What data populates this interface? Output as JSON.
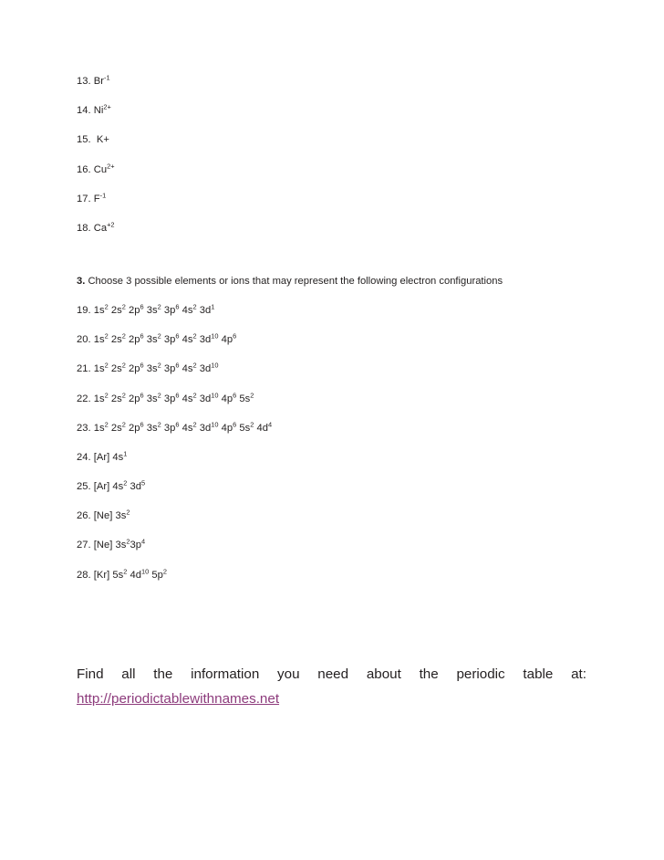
{
  "document": {
    "ions_section": {
      "items": [
        {
          "number": "13.",
          "symbol": "Br",
          "charge": "-1",
          "charge_style": "superscript"
        },
        {
          "number": "14.",
          "symbol": "Ni",
          "charge": "2+",
          "charge_style": "superscript"
        },
        {
          "number": "15.",
          "symbol": " K+",
          "charge": "",
          "charge_style": "inline"
        },
        {
          "number": "16.",
          "symbol": "Cu",
          "charge": "2+",
          "charge_style": "superscript"
        },
        {
          "number": "17.",
          "symbol": "F",
          "charge": "-1",
          "charge_style": "superscript"
        },
        {
          "number": "18.",
          "symbol": "Ca",
          "charge": "+2",
          "charge_style": "superscript"
        }
      ]
    },
    "section3": {
      "number": "3.",
      "prompt": " Choose 3 possible elements or ions that may represent the following electron configurations",
      "items": [
        {
          "number": "19.",
          "parts": [
            {
              "base": "1s",
              "sup": "2"
            },
            {
              "base": "2s",
              "sup": "2"
            },
            {
              "base": "2p",
              "sup": "6"
            },
            {
              "base": "3s",
              "sup": "2"
            },
            {
              "base": "3p",
              "sup": "6"
            },
            {
              "base": "4s",
              "sup": "2"
            },
            {
              "base": "3d",
              "sup": "1"
            }
          ],
          "text": "19. 1s2 2s2 2p6 3s2 3p6 4s2 3d1"
        },
        {
          "number": "20.",
          "parts": [
            {
              "base": "1s",
              "sup": "2"
            },
            {
              "base": "2s",
              "sup": "2"
            },
            {
              "base": "2p",
              "sup": "6"
            },
            {
              "base": "3s",
              "sup": "2"
            },
            {
              "base": "3p",
              "sup": "6"
            },
            {
              "base": "4s",
              "sup": "2"
            },
            {
              "base": "3d",
              "sup": "10"
            },
            {
              "base": "4p",
              "sup": "6"
            }
          ],
          "text": "20. 1s2 2s2 2p6 3s2 3p6 4s2 3d10 4p6"
        },
        {
          "number": "21.",
          "parts": [
            {
              "base": "1s",
              "sup": "2"
            },
            {
              "base": "2s",
              "sup": "2"
            },
            {
              "base": "2p",
              "sup": "6"
            },
            {
              "base": "3s",
              "sup": "2"
            },
            {
              "base": "3p",
              "sup": "6"
            },
            {
              "base": "4s",
              "sup": "2"
            },
            {
              "base": "3d",
              "sup": "10"
            }
          ],
          "text": "21. 1s2 2s2 2p6 3s2 3p6 4s2 3d10"
        },
        {
          "number": "22.",
          "parts": [
            {
              "base": "1s",
              "sup": "2"
            },
            {
              "base": "2s",
              "sup": "2"
            },
            {
              "base": "2p",
              "sup": "6"
            },
            {
              "base": "3s",
              "sup": "2"
            },
            {
              "base": "3p",
              "sup": "6"
            },
            {
              "base": "4s",
              "sup": "2"
            },
            {
              "base": "3d",
              "sup": "10"
            },
            {
              "base": "4p",
              "sup": "6"
            },
            {
              "base": "5s",
              "sup": "2"
            }
          ],
          "text": "22. 1s2 2s2 2p6 3s2 3p6 4s2 3d10 4p6 5s2"
        },
        {
          "number": "23.",
          "parts": [
            {
              "base": "1s",
              "sup": "2"
            },
            {
              "base": "2s",
              "sup": "2"
            },
            {
              "base": "2p",
              "sup": "6"
            },
            {
              "base": "3s",
              "sup": "2"
            },
            {
              "base": "3p",
              "sup": "6"
            },
            {
              "base": "4s",
              "sup": "2"
            },
            {
              "base": "3d",
              "sup": "10"
            },
            {
              "base": "4p",
              "sup": "6"
            },
            {
              "base": "5s",
              "sup": "2"
            },
            {
              "base": "4d",
              "sup": "4"
            }
          ],
          "text": "23. 1s2 2s2 2p6 3s2 3p6 4s2 3d10 4p6 5s2 4d4"
        },
        {
          "number": "24.",
          "parts": [
            {
              "base": "[Ar] 4s",
              "sup": "1"
            }
          ],
          "text": "24. [Ar] 4s1"
        },
        {
          "number": "25.",
          "parts": [
            {
              "base": "[Ar] 4s",
              "sup": "2"
            },
            {
              "base": "3d",
              "sup": "5"
            }
          ],
          "text": "25. [Ar] 4s2 3d5"
        },
        {
          "number": "26.",
          "parts": [
            {
              "base": "[Ne] 3s",
              "sup": "2"
            }
          ],
          "text": "26. [Ne] 3s2"
        },
        {
          "number": "27.",
          "parts": [
            {
              "base": "[Ne] 3s",
              "sup": "2"
            },
            {
              "base": "3p",
              "sup": "4",
              "nospace": true
            }
          ],
          "text": "27. [Ne] 3s23p4"
        },
        {
          "number": "28.",
          "parts": [
            {
              "base": "[Kr] 5s",
              "sup": "2"
            },
            {
              "base": "4d",
              "sup": "10"
            },
            {
              "base": "5p",
              "sup": "2"
            }
          ],
          "text": "28. [Kr] 5s2 4d10 5p2"
        }
      ]
    },
    "footer": {
      "sentence": "Find all the information you need about the periodic table at:",
      "link_text": "http://periodictablewithnames.net",
      "link_color": "#8d3b7c"
    }
  }
}
